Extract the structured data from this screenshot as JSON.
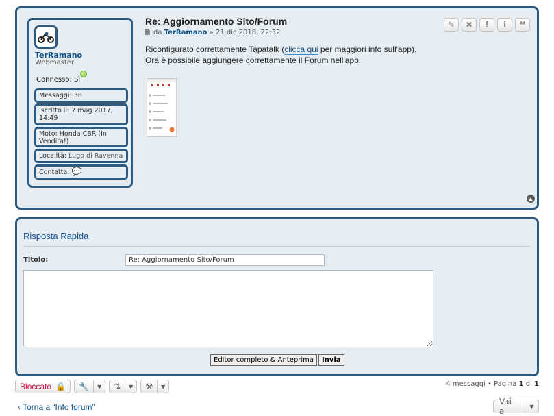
{
  "post": {
    "title": "Re: Aggiornamento Sito/Forum",
    "by_prefix": "da",
    "author": "TerRamano",
    "date": "» 21 dic 2018, 22:32",
    "line1_before": "Riconfigurato correttamente Tapatalk (",
    "link": "clicca qui",
    "line1_after": " per maggiori info sull'app).",
    "line2": "Ora è possibile aggiungere correttamente il Forum nell'app.",
    "buttons": [
      "edit",
      "delete",
      "report",
      "info",
      "quote"
    ]
  },
  "profile": {
    "username": "TerRamano",
    "rank": "Webmaster",
    "online_label": "Connesso: Sì",
    "messages": "Messaggi: 38",
    "joined": "Iscritto il: 7 mag 2017, 14:49",
    "bike": "Moto: Honda CBR (In Vendita!)",
    "location_label": "Località:",
    "location": "Lugo di Ravenna",
    "contact": "Contatta:"
  },
  "quick_reply": {
    "heading": "Risposta Rapida",
    "subject_label": "Titolo:",
    "subject_value": "Re: Aggiornamento Sito/Forum",
    "full_editor": "Editor completo & Anteprima",
    "submit": "Invia"
  },
  "toolbar": {
    "locked": "Bloccato",
    "pagination": "4 messaggi • Pagina ",
    "page": "1",
    "of": " di ",
    "total": "1",
    "back": "Torna a “Info forum”",
    "jump": "Vai a"
  },
  "colors": {
    "border": "#2d5a80",
    "panel": "#e7eef3",
    "link": "#105289",
    "locked": "#d31141"
  }
}
